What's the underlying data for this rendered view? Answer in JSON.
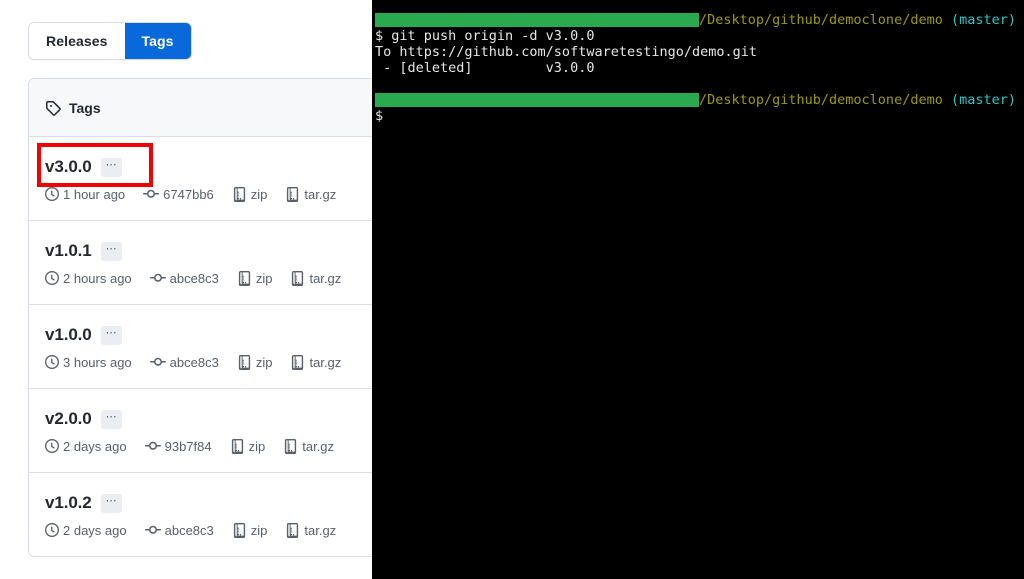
{
  "github": {
    "toggle": {
      "releases_label": "Releases",
      "tags_label": "Tags",
      "active": "Tags",
      "active_bg": "#0969da"
    },
    "card_header": {
      "icon": "tag-icon",
      "label": "Tags"
    },
    "tags": [
      {
        "name": "v3.0.0",
        "ellipsis": "…",
        "age": "1 hour ago",
        "commit": "6747bb6",
        "zip_label": "zip",
        "targz_label": "tar.gz",
        "highlighted": true
      },
      {
        "name": "v1.0.1",
        "ellipsis": "…",
        "age": "2 hours ago",
        "commit": "abce8c3",
        "zip_label": "zip",
        "targz_label": "tar.gz",
        "highlighted": false
      },
      {
        "name": "v1.0.0",
        "ellipsis": "…",
        "age": "3 hours ago",
        "commit": "abce8c3",
        "zip_label": "zip",
        "targz_label": "tar.gz",
        "highlighted": false
      },
      {
        "name": "v2.0.0",
        "ellipsis": "…",
        "age": "2 days ago",
        "commit": "93b7f84",
        "zip_label": "zip",
        "targz_label": "tar.gz",
        "highlighted": false
      },
      {
        "name": "v1.0.2",
        "ellipsis": "…",
        "age": "2 days ago",
        "commit": "abce8c3",
        "zip_label": "zip",
        "targz_label": "tar.gz",
        "highlighted": false
      }
    ],
    "annotation": {
      "color": "#f40000",
      "target": "v3.0.0"
    }
  },
  "terminal": {
    "background": "#000000",
    "prompt_redaction_color": "#2aaa4e",
    "path_color": "#9e9a05",
    "branch_color": "#2bc8c8",
    "prompt1": {
      "path": "/Desktop/github/democlone/demo",
      "branch": "(master)"
    },
    "command": "$ git push origin -d v3.0.0",
    "output": [
      "To https://github.com/softwaretestingo/demo.git",
      " - [deleted]         v3.0.0"
    ],
    "prompt2": {
      "path": "/Desktop/github/democlone/demo",
      "branch": "(master)"
    },
    "cursor_line": "$"
  }
}
